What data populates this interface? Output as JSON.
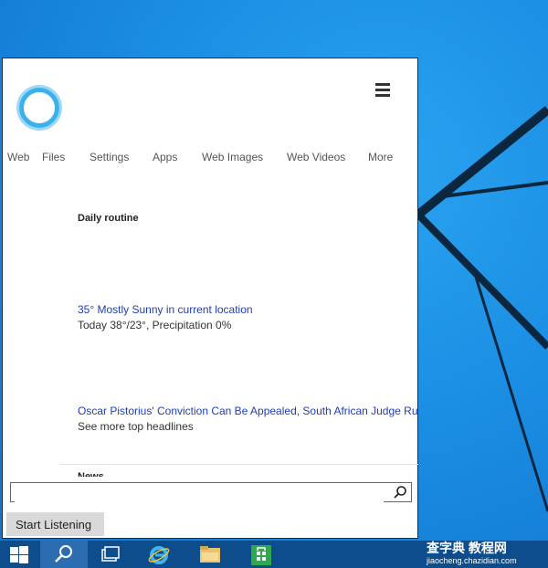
{
  "cortana": {
    "tabs": [
      "Web",
      "Files",
      "Settings",
      "Apps",
      "Web Images",
      "Web Videos",
      "More"
    ]
  },
  "daily": {
    "title": "Daily routine",
    "weather_link": "35° Mostly Sunny in current location",
    "weather_detail": "Today 38°/23°, Precipitation 0%",
    "headline_link": "Oscar Pistorius' Conviction Can Be Appealed, South African Judge Rules",
    "headline_more": "See more top headlines",
    "news_peek": "News"
  },
  "search": {
    "value": "",
    "placeholder": ""
  },
  "listen_label": "Start Listening",
  "watermark": {
    "main": "查字典 教程网",
    "sub": "jiaocheng.chazidian.com"
  },
  "colors": {
    "accent": "#39b1ec",
    "link": "#1e3eb6",
    "taskbar": "#0d4d8c"
  },
  "icons": [
    "cortana-ring-icon",
    "hamburger-menu-icon",
    "search-icon",
    "windows-start-icon",
    "taskbar-search-icon",
    "task-view-icon",
    "internet-explorer-icon",
    "file-explorer-icon",
    "store-icon"
  ]
}
